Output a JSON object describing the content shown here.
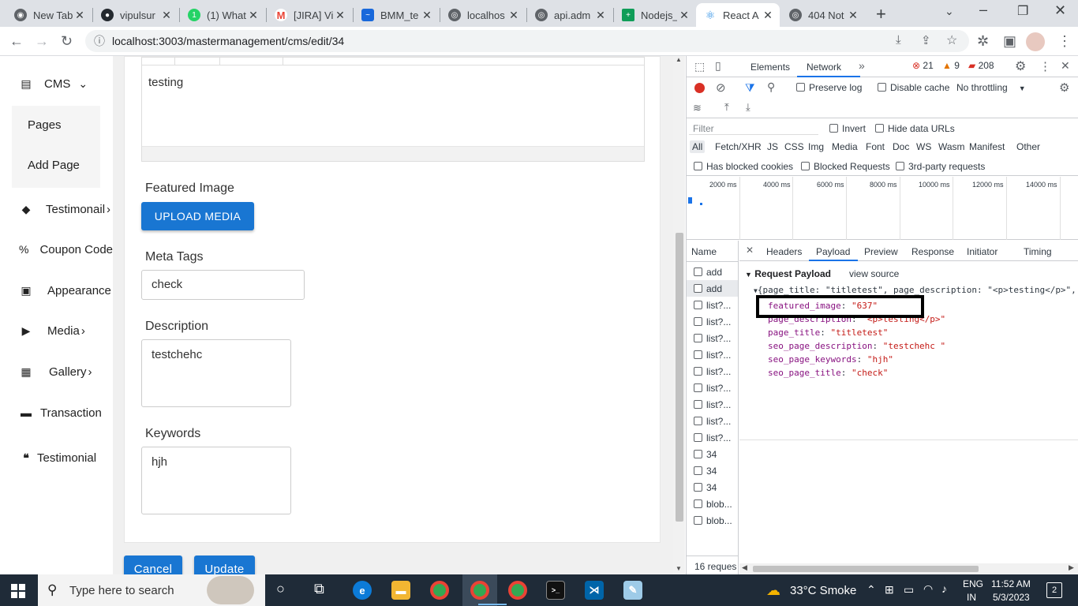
{
  "tabs": [
    {
      "title": "New Tab",
      "icon": "chrome-icon",
      "color": "#5f6368"
    },
    {
      "title": "vipulsur",
      "icon": "github-icon",
      "color": "#24292f"
    },
    {
      "title": "(1) What",
      "icon": "whatsapp-icon",
      "color": "#25d366"
    },
    {
      "title": "[JIRA] Vi",
      "icon": "gmail-icon",
      "color": "#ea4335"
    },
    {
      "title": "BMM_te",
      "icon": "confluence-icon",
      "color": "#1868db"
    },
    {
      "title": "localhos",
      "icon": "globe-icon",
      "color": "#5f6368"
    },
    {
      "title": "api.adm",
      "icon": "globe-icon",
      "color": "#5f6368"
    },
    {
      "title": "Nodejs_",
      "icon": "sheets-icon",
      "color": "#0f9d58"
    },
    {
      "title": "React A",
      "icon": "react-icon",
      "color": "#1e88e5"
    },
    {
      "title": "404 Not",
      "icon": "globe-icon",
      "color": "#5f6368"
    }
  ],
  "address": {
    "url": "localhost:3003/mastermanagement/cms/edit/34"
  },
  "sidebar": {
    "items": [
      {
        "label": "CMS",
        "icon": "document-icon"
      },
      {
        "label": "Pages"
      },
      {
        "label": "Add Page"
      },
      {
        "label": "Testimonail",
        "icon": "tag-icon"
      },
      {
        "label": "Coupon Code",
        "icon": "percent-icon"
      },
      {
        "label": "Appearance",
        "icon": "image-icon"
      },
      {
        "label": "Media",
        "icon": "play-icon"
      },
      {
        "label": "Gallery",
        "icon": "gallery-icon"
      },
      {
        "label": "Transaction",
        "icon": "card-icon"
      },
      {
        "label": "Testimonial",
        "icon": "quote-icon"
      }
    ]
  },
  "form": {
    "editor_text": "testing",
    "featured_image_label": "Featured Image",
    "upload_button": "UPLOAD MEDIA",
    "meta_tags_label": "Meta Tags",
    "meta_tags_value": "check",
    "description_label": "Description",
    "description_value": "testchehc",
    "keywords_label": "Keywords",
    "keywords_value": "hjh",
    "cancel_button": "Cancel",
    "update_button": "Update"
  },
  "devtools": {
    "tabs": [
      "Elements",
      "Network"
    ],
    "errors": "21",
    "warnings": "9",
    "issues": "208",
    "preserve_log": "Preserve log",
    "disable_cache": "Disable cache",
    "throttling": "No throttling",
    "filter_placeholder": "Filter",
    "invert": "Invert",
    "hide_data_urls": "Hide data URLs",
    "type_filters": [
      "All",
      "Fetch/XHR",
      "JS",
      "CSS",
      "Img",
      "Media",
      "Font",
      "Doc",
      "WS",
      "Wasm",
      "Manifest",
      "Other"
    ],
    "has_blocked_cookies": "Has blocked cookies",
    "blocked_requests": "Blocked Requests",
    "third_party": "3rd-party requests",
    "timeline_ticks": [
      "2000 ms",
      "4000 ms",
      "6000 ms",
      "8000 ms",
      "10000 ms",
      "12000 ms",
      "14000 ms"
    ],
    "name_header": "Name",
    "requests": [
      "add",
      "add",
      "list?...",
      "list?...",
      "list?...",
      "list?...",
      "list?...",
      "list?...",
      "list?...",
      "list?...",
      "list?...",
      "34",
      "34",
      "34",
      "blob...",
      "blob..."
    ],
    "request_count": "16 reques",
    "detail_tabs": [
      "Headers",
      "Payload",
      "Preview",
      "Response",
      "Initiator",
      "Timing"
    ],
    "payload_title": "Request Payload",
    "view_source": "view source",
    "payload_summary": "{page_title: \"titletest\", page_description: \"<p>testing</p>\",",
    "payload": [
      {
        "key": "featured_image",
        "value": "\"637\""
      },
      {
        "key": "page_description",
        "value": "\"<p>testing</p>\""
      },
      {
        "key": "page_title",
        "value": "\"titletest\""
      },
      {
        "key": "seo_page_description",
        "value": "\"testchehc \""
      },
      {
        "key": "seo_page_keywords",
        "value": "\"hjh\""
      },
      {
        "key": "seo_page_title",
        "value": "\"check\""
      }
    ]
  },
  "taskbar": {
    "search_placeholder": "Type here to search",
    "weather": "33°C  Smoke",
    "lang": "ENG",
    "region": "IN",
    "time": "11:52 AM",
    "date": "5/3/2023",
    "notifications": "2"
  }
}
